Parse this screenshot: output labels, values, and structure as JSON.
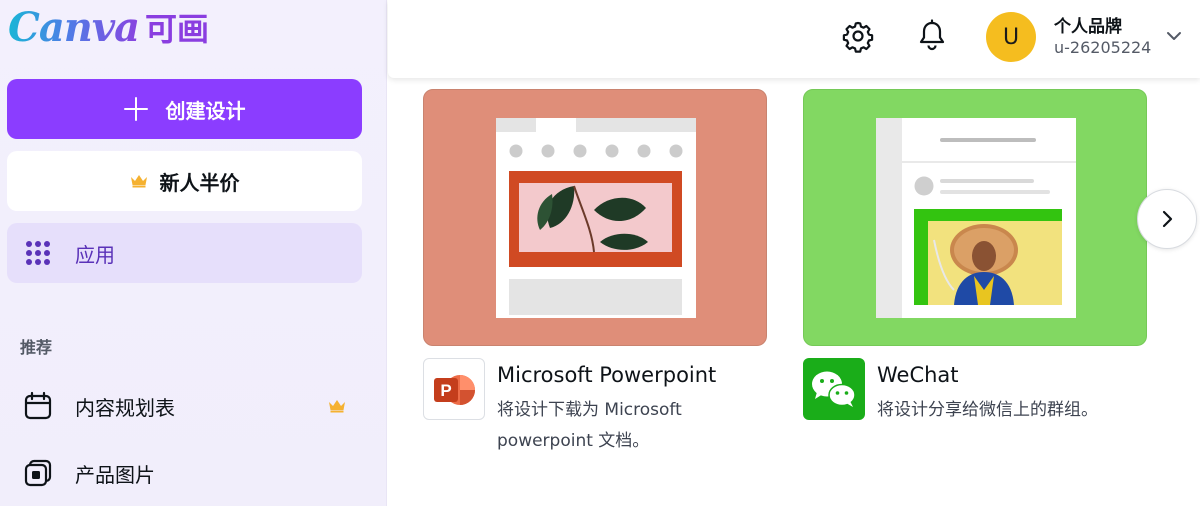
{
  "logo": {
    "word": "Canva",
    "cn": "可画"
  },
  "sidebar": {
    "create_label": "创建设计",
    "half_price_label": "新人半价",
    "apps_label": "应用",
    "section_recommend": "推荐",
    "items": [
      {
        "label": "内容规划表",
        "icon": "calendar-icon",
        "premium": true
      },
      {
        "label": "产品图片",
        "icon": "product-photo-icon",
        "premium": false
      }
    ]
  },
  "header": {
    "avatar_initial": "U",
    "account_name": "个人品牌",
    "account_id": "u-26205224"
  },
  "cards": [
    {
      "title": "Microsoft Powerpoint",
      "description": "将设计下载为 Microsoft powerpoint 文档。",
      "icon": "powerpoint-icon"
    },
    {
      "title": "WeChat",
      "description": "将设计分享给微信上的群组。",
      "icon": "wechat-icon"
    }
  ],
  "colors": {
    "accent": "#8b3dff",
    "sidebar_bg": "#f3f0fd",
    "apps_selected_bg": "#e6dffb",
    "ppt_card": "#df8e79",
    "wechat_card": "#82d862",
    "avatar": "#f5bd1f"
  }
}
